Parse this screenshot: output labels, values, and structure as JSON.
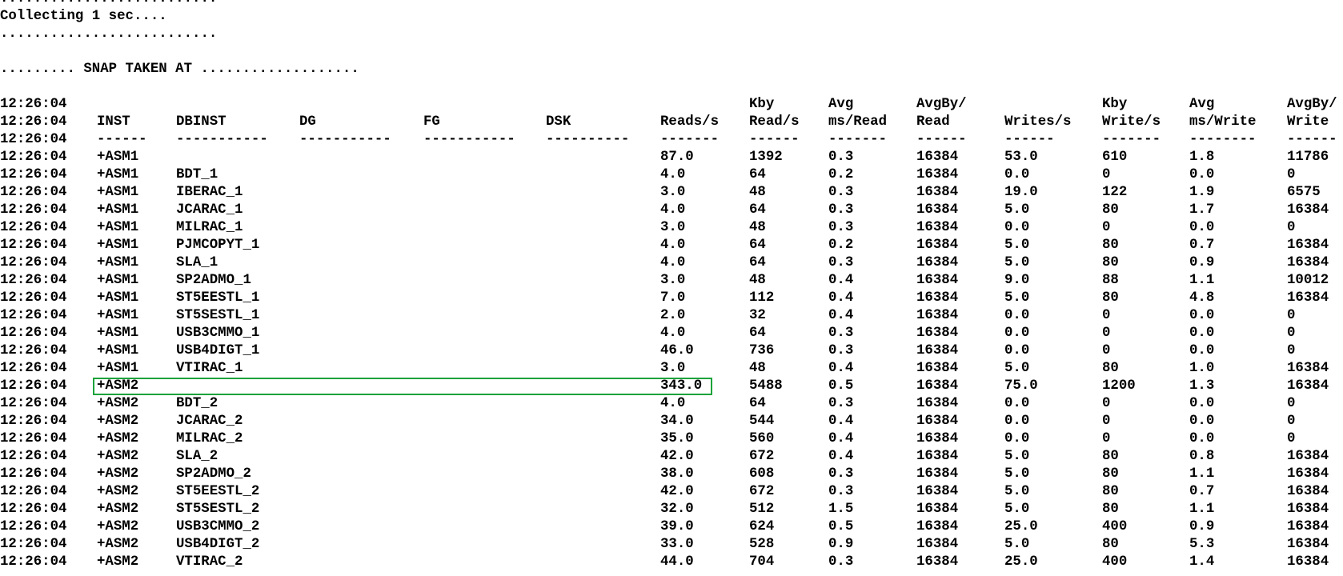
{
  "terminal": {
    "intro_lines": [
      "..........................",
      "Collecting 1 sec....",
      "..........................",
      "",
      "......... SNAP TAKEN AT ..................."
    ],
    "header_rows": [
      [
        "12:26:04",
        "",
        "",
        "",
        "",
        "",
        "",
        "Kby",
        "Avg",
        "AvgBy/",
        "",
        "Kby",
        "Avg",
        "AvgBy/"
      ],
      [
        "12:26:04",
        "INST",
        "DBINST",
        "DG",
        "FG",
        "DSK",
        "Reads/s",
        "Read/s",
        "ms/Read",
        "Read",
        "Writes/s",
        "Write/s",
        "ms/Write",
        "Write"
      ],
      [
        "12:26:04",
        "------",
        "-----------",
        "-----------",
        "-----------",
        "----------",
        "-------",
        "------",
        "-------",
        "------",
        "------",
        "-------",
        "--------",
        "------"
      ]
    ],
    "rows": [
      [
        "12:26:04",
        "+ASM1",
        "",
        "",
        "",
        "",
        "87.0",
        "1392",
        "0.3",
        "16384",
        "53.0",
        "610",
        "1.8",
        "11786"
      ],
      [
        "12:26:04",
        "+ASM1",
        "BDT_1",
        "",
        "",
        "",
        "4.0",
        "64",
        "0.2",
        "16384",
        "0.0",
        "0",
        "0.0",
        "0"
      ],
      [
        "12:26:04",
        "+ASM1",
        "IBERAC_1",
        "",
        "",
        "",
        "3.0",
        "48",
        "0.3",
        "16384",
        "19.0",
        "122",
        "1.9",
        "6575"
      ],
      [
        "12:26:04",
        "+ASM1",
        "JCARAC_1",
        "",
        "",
        "",
        "4.0",
        "64",
        "0.3",
        "16384",
        "5.0",
        "80",
        "1.7",
        "16384"
      ],
      [
        "12:26:04",
        "+ASM1",
        "MILRAC_1",
        "",
        "",
        "",
        "3.0",
        "48",
        "0.3",
        "16384",
        "0.0",
        "0",
        "0.0",
        "0"
      ],
      [
        "12:26:04",
        "+ASM1",
        "PJMCOPYT_1",
        "",
        "",
        "",
        "4.0",
        "64",
        "0.2",
        "16384",
        "5.0",
        "80",
        "0.7",
        "16384"
      ],
      [
        "12:26:04",
        "+ASM1",
        "SLA_1",
        "",
        "",
        "",
        "4.0",
        "64",
        "0.3",
        "16384",
        "5.0",
        "80",
        "0.9",
        "16384"
      ],
      [
        "12:26:04",
        "+ASM1",
        "SP2ADMO_1",
        "",
        "",
        "",
        "3.0",
        "48",
        "0.4",
        "16384",
        "9.0",
        "88",
        "1.1",
        "10012"
      ],
      [
        "12:26:04",
        "+ASM1",
        "ST5EESTL_1",
        "",
        "",
        "",
        "7.0",
        "112",
        "0.4",
        "16384",
        "5.0",
        "80",
        "4.8",
        "16384"
      ],
      [
        "12:26:04",
        "+ASM1",
        "ST5SESTL_1",
        "",
        "",
        "",
        "2.0",
        "32",
        "0.4",
        "16384",
        "0.0",
        "0",
        "0.0",
        "0"
      ],
      [
        "12:26:04",
        "+ASM1",
        "USB3CMMO_1",
        "",
        "",
        "",
        "4.0",
        "64",
        "0.3",
        "16384",
        "0.0",
        "0",
        "0.0",
        "0"
      ],
      [
        "12:26:04",
        "+ASM1",
        "USB4DIGT_1",
        "",
        "",
        "",
        "46.0",
        "736",
        "0.3",
        "16384",
        "0.0",
        "0",
        "0.0",
        "0"
      ],
      [
        "12:26:04",
        "+ASM1",
        "VTIRAC_1",
        "",
        "",
        "",
        "3.0",
        "48",
        "0.4",
        "16384",
        "5.0",
        "80",
        "1.0",
        "16384"
      ],
      [
        "12:26:04",
        "+ASM2",
        "",
        "",
        "",
        "",
        "343.0",
        "5488",
        "0.5",
        "16384",
        "75.0",
        "1200",
        "1.3",
        "16384"
      ],
      [
        "12:26:04",
        "+ASM2",
        "BDT_2",
        "",
        "",
        "",
        "4.0",
        "64",
        "0.3",
        "16384",
        "0.0",
        "0",
        "0.0",
        "0"
      ],
      [
        "12:26:04",
        "+ASM2",
        "JCARAC_2",
        "",
        "",
        "",
        "34.0",
        "544",
        "0.4",
        "16384",
        "0.0",
        "0",
        "0.0",
        "0"
      ],
      [
        "12:26:04",
        "+ASM2",
        "MILRAC_2",
        "",
        "",
        "",
        "35.0",
        "560",
        "0.4",
        "16384",
        "0.0",
        "0",
        "0.0",
        "0"
      ],
      [
        "12:26:04",
        "+ASM2",
        "SLA_2",
        "",
        "",
        "",
        "42.0",
        "672",
        "0.4",
        "16384",
        "5.0",
        "80",
        "0.8",
        "16384"
      ],
      [
        "12:26:04",
        "+ASM2",
        "SP2ADMO_2",
        "",
        "",
        "",
        "38.0",
        "608",
        "0.3",
        "16384",
        "5.0",
        "80",
        "1.1",
        "16384"
      ],
      [
        "12:26:04",
        "+ASM2",
        "ST5EESTL_2",
        "",
        "",
        "",
        "42.0",
        "672",
        "0.3",
        "16384",
        "5.0",
        "80",
        "0.7",
        "16384"
      ],
      [
        "12:26:04",
        "+ASM2",
        "ST5SESTL_2",
        "",
        "",
        "",
        "32.0",
        "512",
        "1.5",
        "16384",
        "5.0",
        "80",
        "1.1",
        "16384"
      ],
      [
        "12:26:04",
        "+ASM2",
        "USB3CMMO_2",
        "",
        "",
        "",
        "39.0",
        "624",
        "0.5",
        "16384",
        "25.0",
        "400",
        "0.9",
        "16384"
      ],
      [
        "12:26:04",
        "+ASM2",
        "USB4DIGT_2",
        "",
        "",
        "",
        "33.0",
        "528",
        "0.9",
        "16384",
        "5.0",
        "80",
        "5.3",
        "16384"
      ],
      [
        "12:26:04",
        "+ASM2",
        "VTIRAC_2",
        "",
        "",
        "",
        "44.0",
        "704",
        "0.3",
        "16384",
        "25.0",
        "400",
        "1.4",
        "16384"
      ]
    ],
    "highlighted_row": 13,
    "highlight_color": "#1aa33a"
  }
}
